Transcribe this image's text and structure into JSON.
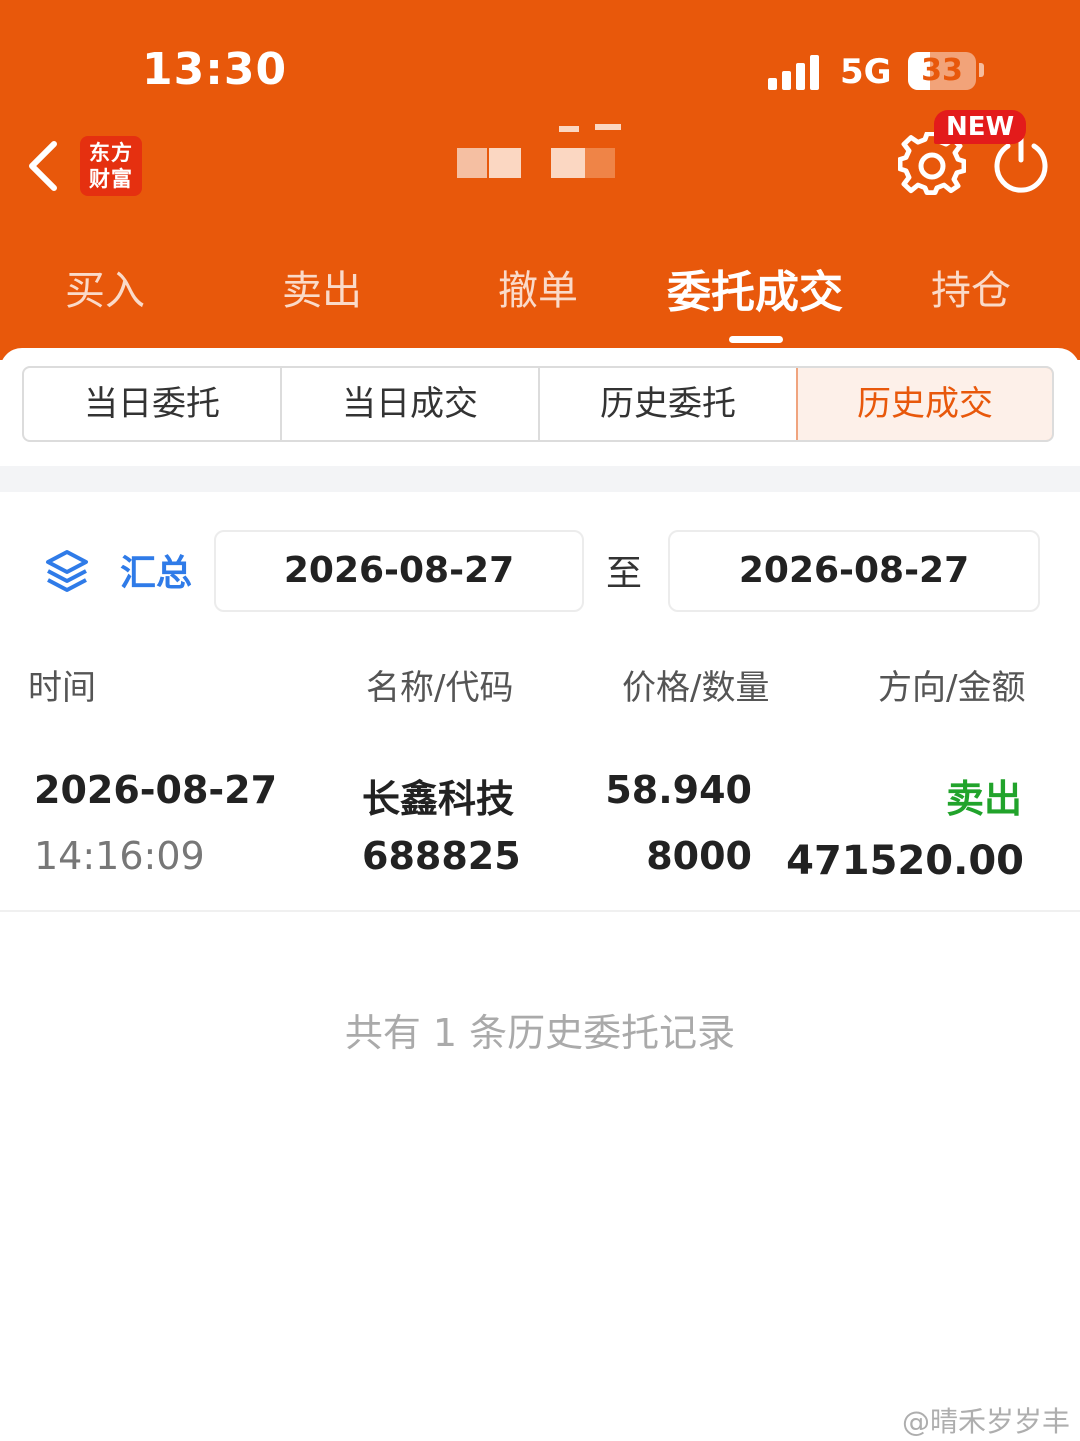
{
  "status_bar": {
    "time": "13:30",
    "network": "5G",
    "battery": "33",
    "battery_level": 0.33
  },
  "top_bar": {
    "logo_text_line1": "东方",
    "logo_text_line2": "财富",
    "new_badge": "NEW",
    "icons": [
      "back-arrow-icon",
      "gear-icon",
      "power-icon"
    ]
  },
  "main_tabs": [
    "买入",
    "卖出",
    "撤单",
    "委托成交",
    "持仓"
  ],
  "main_tab_active": "委托成交",
  "sub_tabs": [
    "当日委托",
    "当日成交",
    "历史委托",
    "历史成交"
  ],
  "sub_tab_active": "历史成交",
  "filter": {
    "summary_label": "汇总",
    "start_date": "2026-08-27",
    "to_label": "至",
    "end_date": "2026-08-27"
  },
  "table": {
    "headers": [
      "时间",
      "名称/代码",
      "价格/数量",
      "方向/金额"
    ],
    "rows": [
      {
        "date": "2026-08-27",
        "time": "14:16:09",
        "name": "长鑫科技",
        "code": "688825",
        "price": "58.940",
        "quantity": "8000",
        "direction": "卖出",
        "amount": "471520.00"
      }
    ]
  },
  "footer_note": "共有 1 条历史委托记录",
  "watermark": "@晴禾岁岁丰",
  "colors": {
    "header": "#e8580b",
    "accent": "#e8580b",
    "link": "#2f7be8",
    "sell": "#21a32b"
  }
}
